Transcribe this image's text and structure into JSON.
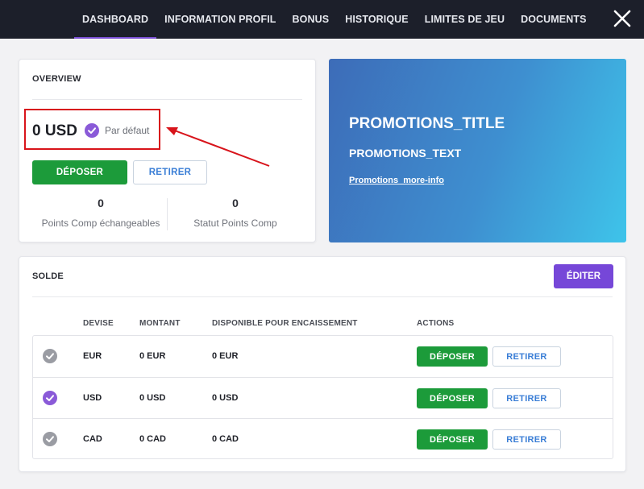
{
  "nav": {
    "items": [
      {
        "label": "DASHBOARD",
        "active": true
      },
      {
        "label": "INFORMATION PROFIL",
        "active": false
      },
      {
        "label": "BONUS",
        "active": false
      },
      {
        "label": "HISTORIQUE",
        "active": false
      },
      {
        "label": "LIMITES DE JEU",
        "active": false
      },
      {
        "label": "DOCUMENTS",
        "active": false
      }
    ],
    "close_icon": "close-icon"
  },
  "overview": {
    "title": "OVERVIEW",
    "balance": "0 USD",
    "default_label": "Par défaut",
    "deposit_label": "DÉPOSER",
    "withdraw_label": "RETIRER",
    "stats": [
      {
        "value": "0",
        "label": "Points Comp échangeables"
      },
      {
        "value": "0",
        "label": "Statut Points Comp"
      }
    ]
  },
  "promotions": {
    "title": "PROMOTIONS_TITLE",
    "text": "PROMOTIONS_TEXT",
    "link": "Promotions_more-info"
  },
  "solde": {
    "title": "SOLDE",
    "edit_label": "ÉDITER",
    "columns": [
      "DEVISE",
      "MONTANT",
      "DISPONIBLE POUR ENCAISSEMENT",
      "ACTIONS"
    ],
    "rows": [
      {
        "currency": "EUR",
        "amount": "0 EUR",
        "available": "0 EUR",
        "default": false,
        "deposit": "DÉPOSER",
        "withdraw": "RETIRER"
      },
      {
        "currency": "USD",
        "amount": "0 USD",
        "available": "0 USD",
        "default": true,
        "deposit": "DÉPOSER",
        "withdraw": "RETIRER"
      },
      {
        "currency": "CAD",
        "amount": "0 CAD",
        "available": "0 CAD",
        "default": false,
        "deposit": "DÉPOSER",
        "withdraw": "RETIRER"
      }
    ]
  },
  "colors": {
    "nav_bg": "#1c1f2a",
    "accent_purple": "#7647d8",
    "deposit_green": "#1c9b3a",
    "withdraw_blue": "#3a7ed6",
    "annotation_red": "#d8141b",
    "check_grey": "#9a9ca3"
  }
}
